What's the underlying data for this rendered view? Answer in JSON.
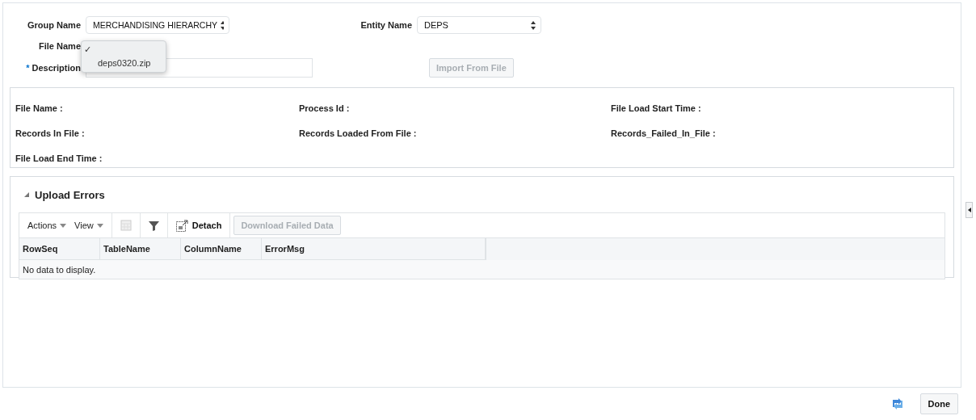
{
  "form": {
    "group_name": {
      "label": "Group Name",
      "value": "MERCHANDISING HIERARCHY"
    },
    "entity_name": {
      "label": "Entity Name",
      "value": "DEPS"
    },
    "file_name": {
      "label": "File Name",
      "dropdown": {
        "check_mark": "✓",
        "options": [
          {
            "label": "deps0320.zip",
            "selected": false
          }
        ]
      }
    },
    "description": {
      "label": "Description",
      "required_mark": "*",
      "required": true
    },
    "import_button": {
      "label": "Import From File",
      "disabled": true
    }
  },
  "info": [
    {
      "label": "File Name :"
    },
    {
      "label": "Process Id :"
    },
    {
      "label": "File Load Start Time :"
    },
    {
      "label": "Records In File :"
    },
    {
      "label": "Records Loaded From File :"
    },
    {
      "label": "Records_Failed_In_File :"
    },
    {
      "label": "File Load End Time :"
    }
  ],
  "upload_errors": {
    "title": "Upload Errors",
    "expanded": true,
    "toolbar": {
      "menus": [
        "Actions",
        "View"
      ],
      "detach": "Detach",
      "download": {
        "label": "Download Failed Data",
        "disabled": true
      }
    },
    "table": {
      "columns": [
        "RowSeq",
        "TableName",
        "ColumnName",
        "ErrorMsg"
      ],
      "empty_text": "No data to display."
    }
  },
  "footer": {
    "done": "Done"
  }
}
